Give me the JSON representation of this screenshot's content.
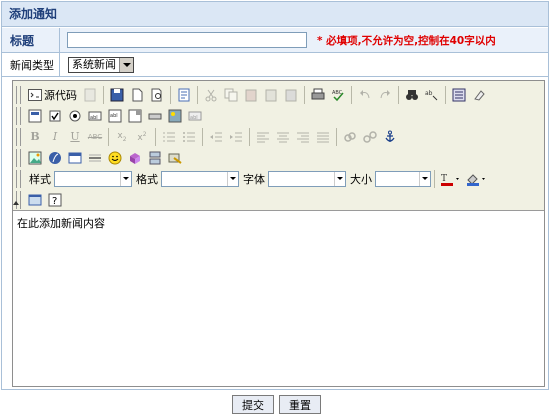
{
  "header": {
    "title": "添加通知"
  },
  "form": {
    "title_label": "标题",
    "title_value": "",
    "title_hint": "* 必填项,不允许为空,控制在40字以内",
    "type_label": "新闻类型",
    "type_value": "系统新闻"
  },
  "editor": {
    "source_label": "源代码",
    "style_label": "样式",
    "format_label": "格式",
    "font_label": "字体",
    "size_label": "大小",
    "content": "在此添加新闻内容"
  },
  "actions": {
    "submit_label": "提交",
    "reset_label": "重置"
  }
}
